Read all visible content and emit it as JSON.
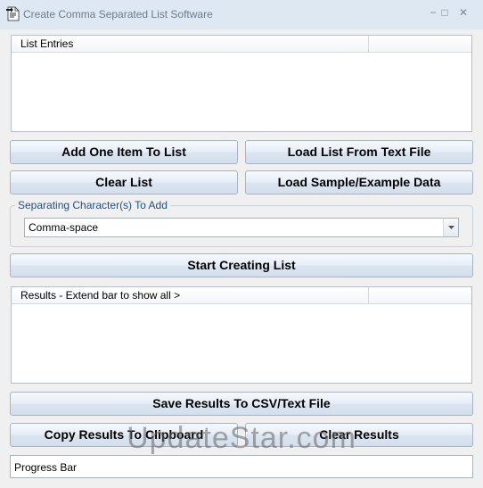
{
  "window": {
    "title": "Create Comma Separated List Software",
    "minimize_glyph": "−",
    "maximize_glyph": "□",
    "close_glyph": "✕"
  },
  "list_entries": {
    "column_header": "List Entries"
  },
  "buttons": {
    "add_one_item": "Add One Item To List",
    "load_from_file": "Load List From Text File",
    "clear_list": "Clear List",
    "load_sample": "Load Sample/Example Data",
    "start_creating": "Start Creating List",
    "save_results": "Save Results To CSV/Text File",
    "copy_results": "Copy Results To Clipboard",
    "clear_results": "Clear Results"
  },
  "separator_group": {
    "label": "Separating Character(s) To Add",
    "selected_value": "Comma-space"
  },
  "results": {
    "column_header": "Results - Extend bar to show all >",
    "column_header_suffix": ">"
  },
  "progress": {
    "label": "Progress Bar"
  },
  "watermark": {
    "text": "UpdateStar.com"
  },
  "colors": {
    "window_frame": "#dee8f3",
    "client_background": "#f0f0f0",
    "group_label": "#1f4f8b",
    "button_border": "#a8b4c2"
  },
  "icons": {
    "app_icon": "document-arrow-icon",
    "dropdown_arrow": "chevron-down-icon"
  }
}
